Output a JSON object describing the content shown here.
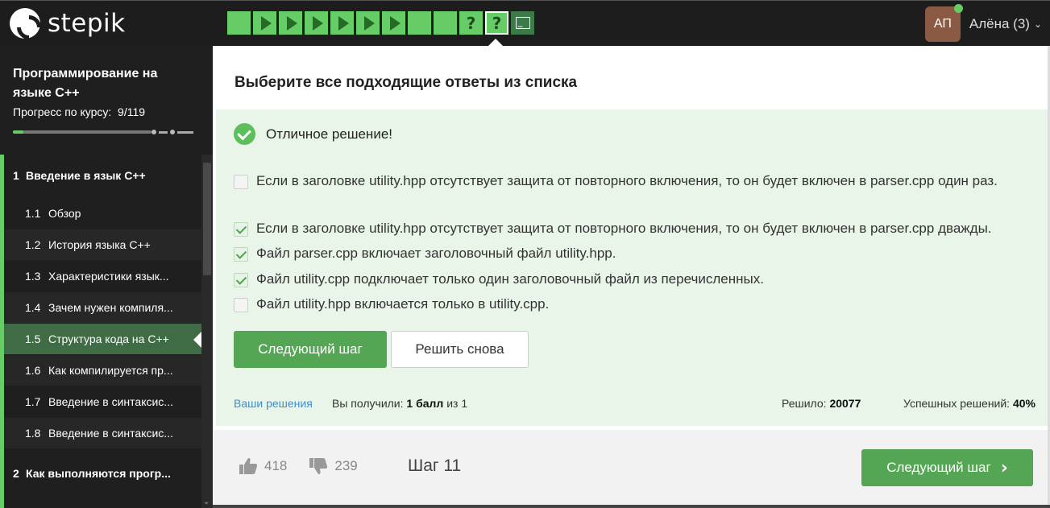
{
  "brand": {
    "name": "stepik"
  },
  "steps": [
    {
      "type": "text",
      "active": false
    },
    {
      "type": "video",
      "active": false
    },
    {
      "type": "video",
      "active": false
    },
    {
      "type": "video",
      "active": false
    },
    {
      "type": "video",
      "active": false
    },
    {
      "type": "video",
      "active": false
    },
    {
      "type": "video",
      "active": false
    },
    {
      "type": "text",
      "active": false
    },
    {
      "type": "text",
      "active": false
    },
    {
      "type": "quiz",
      "label": "?",
      "active": false
    },
    {
      "type": "quiz",
      "label": "?",
      "active": true
    },
    {
      "type": "code",
      "active": false
    }
  ],
  "user": {
    "initials": "АП",
    "name": "Алёна (3)",
    "online": true
  },
  "course": {
    "title": "Программирование на языке С++",
    "progress_label": "Прогресс по курсу:",
    "progress_value": "9/119",
    "progress_fraction": 0.0756
  },
  "sidebar": {
    "sections": [
      {
        "num": "1",
        "name": "Введение в язык С++"
      },
      {
        "num": "2",
        "name": "Как выполняются прогр..."
      }
    ],
    "lessons": [
      {
        "num": "1.1",
        "name": "Обзор",
        "current": false
      },
      {
        "num": "1.2",
        "name": "История языка C++",
        "current": false
      },
      {
        "num": "1.3",
        "name": "Характеристики язык...",
        "current": false
      },
      {
        "num": "1.4",
        "name": "Зачем нужен компиля...",
        "current": false
      },
      {
        "num": "1.5",
        "name": "Структура кода на С++",
        "current": true
      },
      {
        "num": "1.6",
        "name": "Как компилируется пр...",
        "current": false
      },
      {
        "num": "1.7",
        "name": "Введение в синтаксис...",
        "current": false
      },
      {
        "num": "1.8",
        "name": "Введение в синтаксис...",
        "current": false
      }
    ]
  },
  "question": {
    "title": "Выберите все подходящие ответы из списка",
    "result": "Отличное решение!",
    "options": [
      {
        "text": "Если в заголовке utility.hpp отсутствует защита от повторного включения, то он будет включен в parser.cpp один раз.",
        "checked": false
      },
      {
        "text": "Если в заголовке utility.hpp отсутствует защита от повторного включения, то он будет включен в parser.cpp дважды.",
        "checked": true
      },
      {
        "text": "Файл parser.cpp включает заголовочный файл utility.hpp.",
        "checked": true
      },
      {
        "text": "Файл utility.cpp подключает только один заголовочный файл из перечисленных.",
        "checked": true
      },
      {
        "text": "Файл utility.hpp включается только в utility.cpp.",
        "checked": false
      }
    ],
    "next_button": "Следующий шаг",
    "retry_button": "Решить снова"
  },
  "stats": {
    "your_solutions": "Ваши решения",
    "score_prefix": "Вы получили:",
    "score_value": "1 балл",
    "score_suffix": "из 1",
    "solved_label": "Решило:",
    "solved_value": "20077",
    "success_label": "Успешных решений:",
    "success_value": "40%"
  },
  "footer": {
    "likes": "418",
    "dislikes": "239",
    "step_label": "Шаг 11",
    "next_button": "Следующий шаг"
  },
  "colors": {
    "accent": "#66cc66",
    "button": "#54a654",
    "link": "#3a8fcf",
    "topbar": "#1d1d1d",
    "sidebar": "#1f1f1f"
  }
}
